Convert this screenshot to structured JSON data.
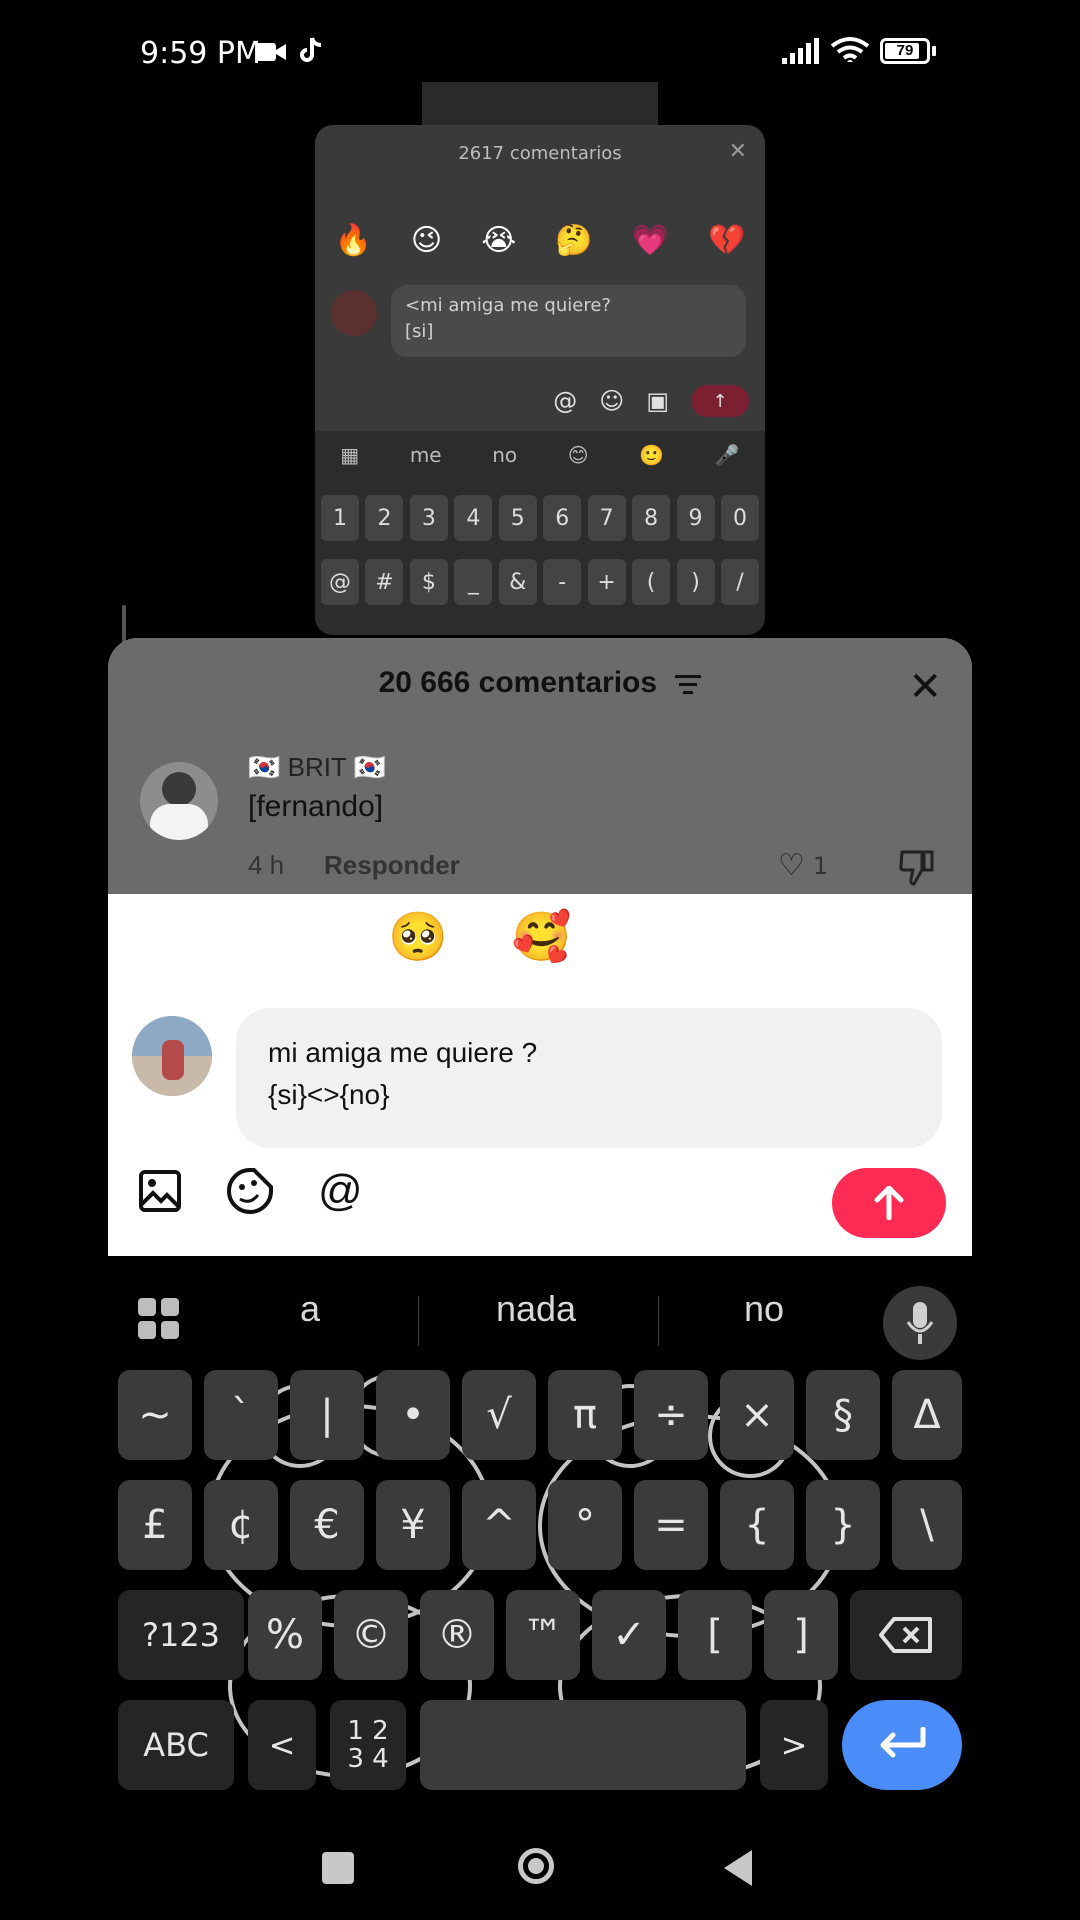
{
  "status_bar": {
    "time": "9:59 PM",
    "battery": "79",
    "icons": [
      "video-camera-icon",
      "tiktok-icon",
      "signal-icon",
      "wifi-icon",
      "battery-icon"
    ]
  },
  "background_screenshot": {
    "title": "2617 comentarios",
    "emojis": [
      "🔥",
      "😉",
      "😭",
      "🤔",
      "💗",
      "💔"
    ],
    "input_line1": "<mi amiga me quiere?",
    "input_line2": "[si]",
    "suggestions": [
      "me",
      "no",
      "😊",
      "🙂"
    ],
    "number_row": [
      "1",
      "2",
      "3",
      "4",
      "5",
      "6",
      "7",
      "8",
      "9",
      "0"
    ],
    "symbol_row": [
      "@",
      "#",
      "$",
      "_",
      "&",
      "-",
      "+",
      "(",
      ")",
      "/"
    ]
  },
  "comments_panel": {
    "title": "20 666 comentarios",
    "comment": {
      "username": "🇰🇷 BRIT 🇰🇷",
      "text": "[fernando]",
      "time": "4 h",
      "reply_label": "Responder",
      "likes": "1"
    },
    "quick_emojis": [
      "😁",
      "😳",
      "🥺",
      "🥰",
      "😂",
      "😏",
      "😅"
    ],
    "input_line1": "mi amiga me quiere ?",
    "input_line2": "{si}<>{no}"
  },
  "keyboard": {
    "suggestions": [
      "a",
      "nada",
      "no"
    ],
    "row1": [
      "~",
      "`",
      "|",
      "•",
      "√",
      "π",
      "÷",
      "×",
      "§",
      "Δ"
    ],
    "row2": [
      "£",
      "¢",
      "€",
      "¥",
      "^",
      "°",
      "=",
      "{",
      "}",
      "\\"
    ],
    "row3_left": "?123",
    "row3": [
      "%",
      "©",
      "®",
      "™",
      "✓",
      "[",
      "]"
    ],
    "row4_left": "ABC",
    "row4_lt": "<",
    "row4_numpad_top": "1 2",
    "row4_numpad_bottom": "3 4",
    "row4_gt": ">"
  },
  "colors": {
    "send_button": "#fe2c55",
    "enter_key": "#4a8df8"
  }
}
